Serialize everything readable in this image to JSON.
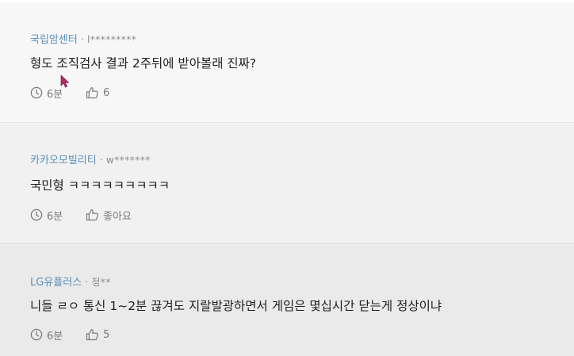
{
  "posts": [
    {
      "company": "국립암센터",
      "user": "l*********",
      "body": "형도 조직검사 결과 2주뒤에 받아볼래 진짜?",
      "time": "6분",
      "likes": "6"
    },
    {
      "company": "카카오모빌리티",
      "user": "w*******",
      "body": "국민형 ㅋㅋㅋㅋㅋㅋㅋㅋㅋ",
      "time": "6분",
      "likes": "좋아요"
    },
    {
      "company": "LG유플러스",
      "user": "정**",
      "body": "니들 ㄹㅇ 통신 1~2분 끊겨도 지랄발광하면서 게임은 몇십시간 닫는게 정상이냐",
      "time": "6분",
      "likes": "5"
    }
  ],
  "separator": "·",
  "colors": {
    "company": "#5a8fb8",
    "body_text": "#1f1f1f",
    "meta_text": "#7a7a7a",
    "cursor": "#b0306a"
  },
  "icons": {
    "time": "clock-icon",
    "like": "thumbs-up-icon",
    "pointer": "mouse-cursor-icon"
  }
}
